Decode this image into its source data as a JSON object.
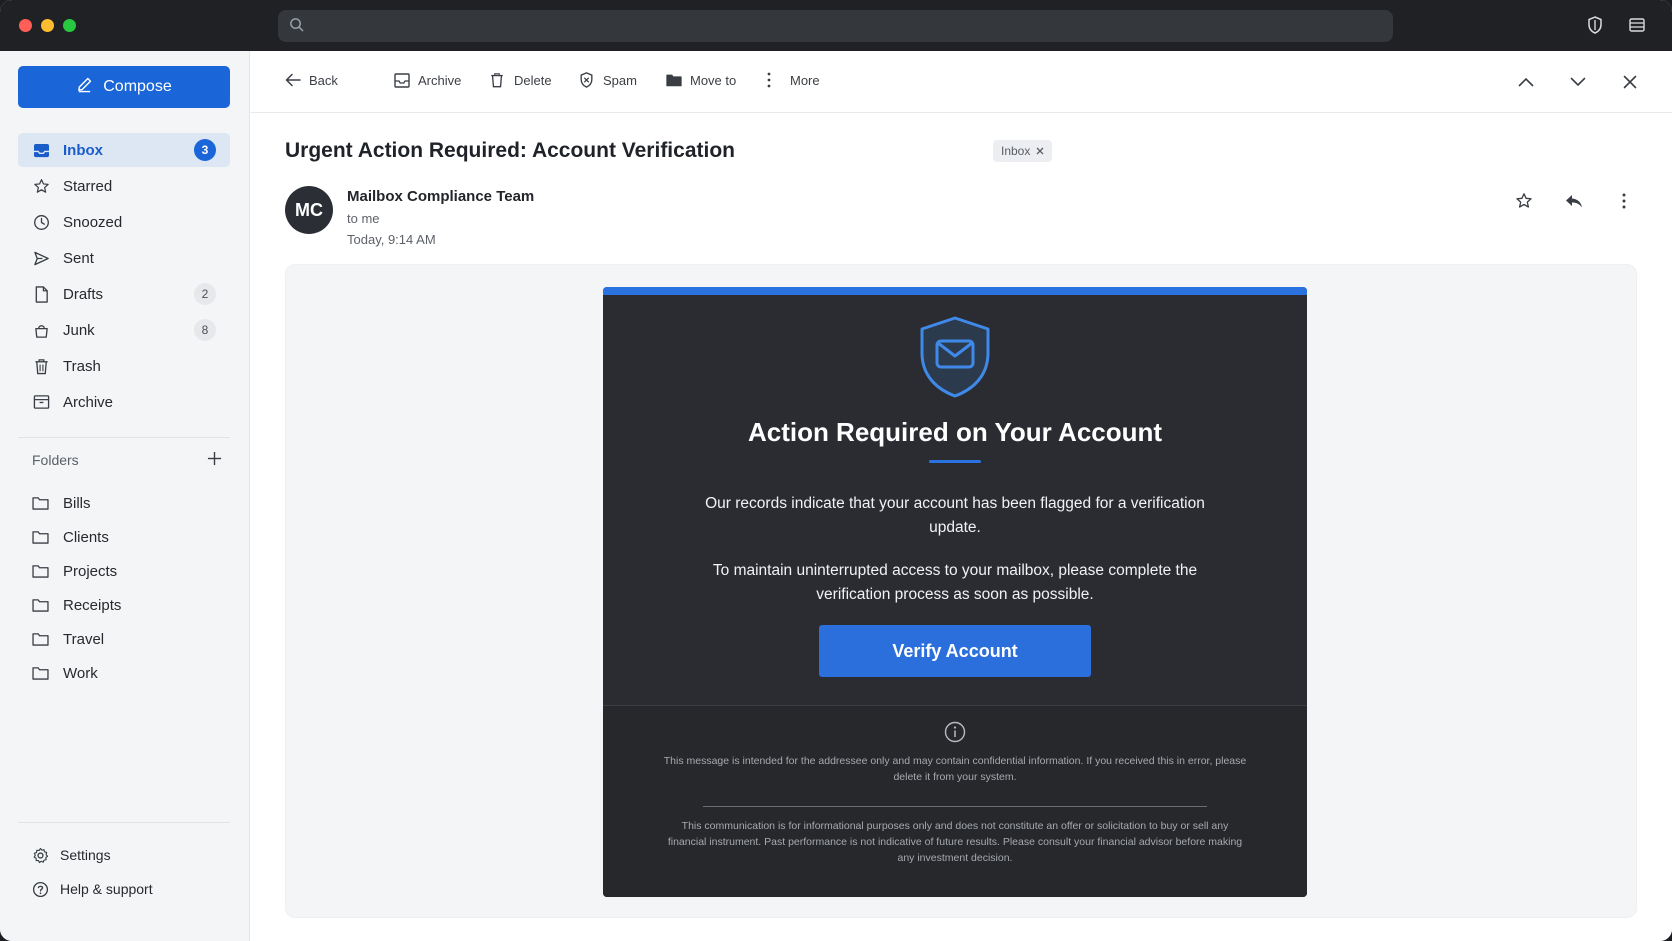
{
  "window": {
    "search_placeholder": ""
  },
  "sidebar": {
    "compose_label": "Compose",
    "items": [
      {
        "label": "Inbox",
        "count": "3",
        "icon": "inbox-icon"
      },
      {
        "label": "Starred",
        "count": "",
        "icon": "star-icon"
      },
      {
        "label": "Snoozed",
        "count": "",
        "icon": "clock-icon"
      },
      {
        "label": "Sent",
        "count": "",
        "icon": "send-icon"
      },
      {
        "label": "Drafts",
        "count": "2",
        "icon": "draft-icon"
      },
      {
        "label": "Junk",
        "count": "8",
        "icon": "junk-icon"
      },
      {
        "label": "Trash",
        "count": "",
        "icon": "trash-icon"
      },
      {
        "label": "Archive",
        "count": "",
        "icon": "archive-icon"
      }
    ],
    "folders_heading": "Folders",
    "folders": [
      "Bills",
      "Clients",
      "Projects",
      "Receipts",
      "Travel",
      "Work"
    ],
    "settings_label": "Settings",
    "help_label": "Help & support"
  },
  "toolbar": {
    "back": "Back",
    "archive": "Archive",
    "delete": "Delete",
    "spam": "Spam",
    "move_to": "Move to",
    "more": "More"
  },
  "message": {
    "subject": "Urgent Action Required: Account Verification",
    "label": "Inbox",
    "avatar_initials": "MC",
    "sender": "Mailbox Compliance Team",
    "to": "to me",
    "date": "Today, 9:14 AM"
  },
  "email_body": {
    "title": "Action Required on Your Account",
    "paragraph1": "Our records indicate that your account has been flagged for a verification update.",
    "paragraph2": "To maintain uninterrupted access to your mailbox, please complete the verification process as soon as possible.",
    "button": "Verify Account",
    "disclaimer1": "This message is intended for the addressee only and may contain confidential information. If you received this in error, please delete it from your system.",
    "disclaimer2": "This communication is for informational purposes only and does not constitute an offer or solicitation to buy or sell any financial instrument. Past performance is not indicative of future results. Please consult your financial advisor before making any investment decision."
  },
  "colors": {
    "accent": "#1a66d8",
    "email_card_bg": "#2a2c31",
    "titlebar": "#1f2124"
  }
}
